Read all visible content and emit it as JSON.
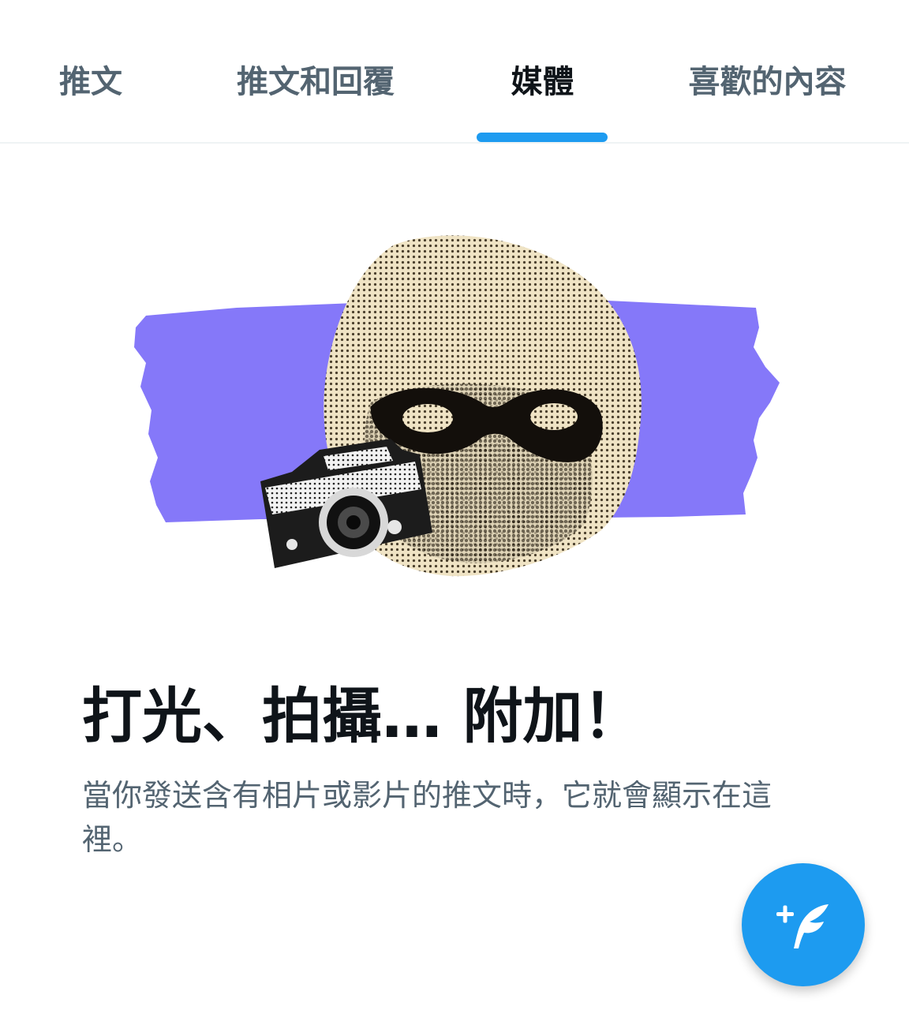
{
  "tabs": [
    {
      "label": "推文",
      "active": false
    },
    {
      "label": "推文和回覆",
      "active": false
    },
    {
      "label": "媒體",
      "active": true
    },
    {
      "label": "喜歡的內容",
      "active": false
    }
  ],
  "empty_state": {
    "title": "打光、拍攝… 附加！",
    "description": "當你發送含有相片或影片的推文時，它就會顯示在這裡。"
  },
  "fab": {
    "icon": "compose-tweet-icon"
  },
  "colors": {
    "accent": "#1d9bf0",
    "primary_text": "#0f1419",
    "secondary_text": "#536471",
    "illustration_stripe": "#8578f9"
  }
}
